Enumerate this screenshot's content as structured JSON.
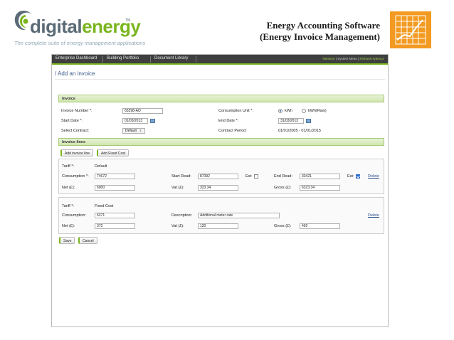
{
  "branding": {
    "logo_word_digital": "digital",
    "logo_word_energy": "energy",
    "trademark": "TM",
    "tagline": "The complete suite of energy management applications"
  },
  "slide": {
    "title_line1": "Energy Accounting Software",
    "title_line2": "(Energy Invoice Management)",
    "tile_icon": "line-chart-icon",
    "tile_color": "#f29a21"
  },
  "nav": {
    "tabs": [
      "Enterprise Dashboard",
      "Building Portfolio",
      "Document Library"
    ],
    "right_links": [
      "Netstore",
      "System Menu",
      "Richard Hydeout"
    ],
    "separator": "|"
  },
  "page": {
    "title": "/ Add an invoice"
  },
  "invoice": {
    "section_label": "Invoice",
    "invoice_number_label": "Invoice Number *:",
    "invoice_number_value": "65398-AO",
    "start_date_label": "Start Date *:",
    "start_date_value": "01/03/2013",
    "select_contract_label": "Select Contract:",
    "select_contract_value": "Default",
    "consumption_unit_label": "Consumption Unit *:",
    "unit_options": [
      "kWh",
      "kWh(Raw)"
    ],
    "unit_selected": "kWh",
    "end_date_label": "End Date *:",
    "end_date_value": "31/03/2013",
    "contract_period_label": "Contract Period:",
    "contract_period_value": "01/01/2005 - 01/01/2015"
  },
  "invoice_lines": {
    "section_label": "Invoice lines",
    "add_invoice_line_label": "Add invoice line",
    "add_fixed_cost_label": "Add Fixed Cost",
    "delete_label": "Delete",
    "line1": {
      "tariff_label": "Tariff *:",
      "tariff_value": "Default",
      "consumption_label": "Consumption *:",
      "consumption_value": "74672",
      "start_read_label": "Start Read:",
      "start_read_value": "87392",
      "est_label": "Est:",
      "est_start_checked": false,
      "end_read_label": "End Read:",
      "end_read_value": "33421",
      "est_end_checked": true,
      "net_label": "Net (£):",
      "net_value": "6000",
      "vat_label": "Vat (£):",
      "vat_value": "323.34",
      "gross_label": "Gross (£):",
      "gross_value": "6323.34"
    },
    "line2": {
      "tariff_label": "Tariff *:",
      "tariff_value": "Fixed Cost",
      "consumption_label": "Consumption:",
      "consumption_value": "6371",
      "description_label": "Description:",
      "description_value": "Additional meter rate",
      "net_label": "Net (£):",
      "net_value": "372",
      "vat_label": "Vat (£):",
      "vat_value": "120",
      "gross_label": "Gross (£):",
      "gross_value": "492"
    }
  },
  "actions": {
    "save_label": "Save",
    "cancel_label": "Cancel"
  },
  "colors": {
    "brand_green": "#7ab51d",
    "brand_grey": "#5a6b76",
    "nav_bg": "#3f3f3f",
    "link_blue": "#2a4f8a",
    "tile_orange": "#f29a21"
  }
}
